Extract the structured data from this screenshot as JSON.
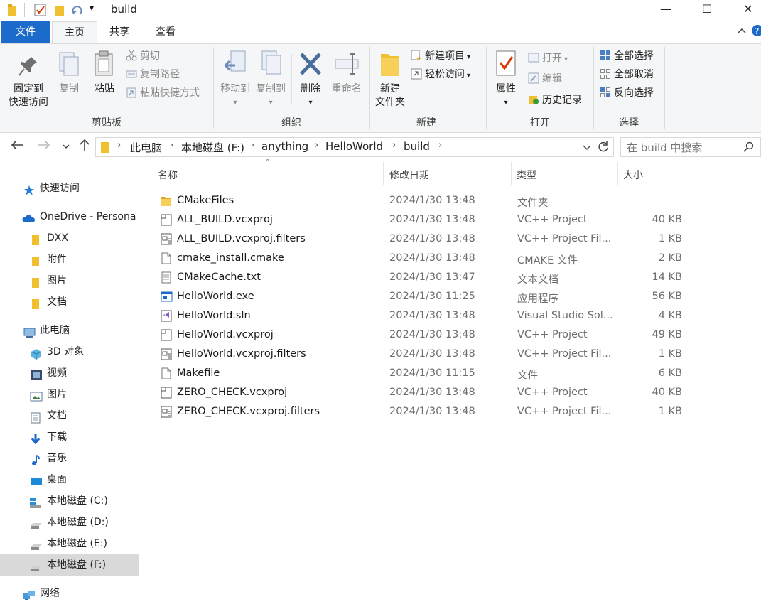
{
  "window": {
    "title": "build",
    "minimize": "—",
    "maximize": "☐",
    "close": "✕",
    "quick_access_arrow": "▾"
  },
  "ribbon_tabs": [
    "文件",
    "主页",
    "共享",
    "查看"
  ],
  "ribbon": {
    "clipboard": {
      "pin_line1": "固定到",
      "pin_line2": "快速访问",
      "copy": "复制",
      "paste": "粘贴",
      "cut": "剪切",
      "copy_path": "复制路径",
      "paste_shortcut": "粘贴快捷方式",
      "label": "剪贴板"
    },
    "organize": {
      "move_to": "移动到",
      "copy_to": "复制到",
      "delete": "删除",
      "rename": "重命名",
      "label": "组织"
    },
    "new": {
      "new_folder_line1": "新建",
      "new_folder_line2": "文件夹",
      "new_item": "新建项目",
      "easy_access": "轻松访问",
      "label": "新建"
    },
    "open": {
      "properties": "属性",
      "open": "打开",
      "edit": "编辑",
      "history": "历史记录",
      "label": "打开"
    },
    "select": {
      "select_all": "全部选择",
      "select_none": "全部取消",
      "invert": "反向选择",
      "label": "选择"
    }
  },
  "address": {
    "crumbs": [
      "此电脑",
      "本地磁盘 (F:)",
      "anything",
      "HelloWorld",
      "build"
    ],
    "search_placeholder": "在 build 中搜索"
  },
  "sidebar": [
    {
      "label": "快速访问",
      "icon": "star-icon"
    },
    {
      "label": "OneDrive - Persona",
      "icon": "cloud-icon"
    },
    {
      "label": "DXX",
      "icon": "folder-icon"
    },
    {
      "label": "附件",
      "icon": "folder-icon"
    },
    {
      "label": "图片",
      "icon": "folder-icon"
    },
    {
      "label": "文档",
      "icon": "folder-icon"
    },
    {
      "label": "此电脑",
      "icon": "computer-icon"
    },
    {
      "label": "3D 对象",
      "icon": "cube-icon"
    },
    {
      "label": "视频",
      "icon": "film-icon"
    },
    {
      "label": "图片",
      "icon": "picture-icon"
    },
    {
      "label": "文档",
      "icon": "document-icon"
    },
    {
      "label": "下载",
      "icon": "download-icon"
    },
    {
      "label": "音乐",
      "icon": "music-icon"
    },
    {
      "label": "桌面",
      "icon": "desktop-icon"
    },
    {
      "label": "本地磁盘 (C:)",
      "icon": "drive-icon"
    },
    {
      "label": "本地磁盘 (D:)",
      "icon": "drive-icon"
    },
    {
      "label": "本地磁盘 (E:)",
      "icon": "drive-icon"
    },
    {
      "label": "本地磁盘 (F:)",
      "icon": "drive-icon",
      "selected": true
    },
    {
      "label": "网络",
      "icon": "network-icon"
    }
  ],
  "columns": {
    "name": "名称",
    "date": "修改日期",
    "type": "类型",
    "size": "大小",
    "sort_indicator": "^"
  },
  "files": [
    {
      "name": "CMakeFiles",
      "date": "2024/1/30 13:48",
      "type": "文件夹",
      "size": "",
      "icon": "folder-icon"
    },
    {
      "name": "ALL_BUILD.vcxproj",
      "date": "2024/1/30 13:48",
      "type": "VC++ Project",
      "size": "40 KB",
      "icon": "vcxproj-icon"
    },
    {
      "name": "ALL_BUILD.vcxproj.filters",
      "date": "2024/1/30 13:48",
      "type": "VC++ Project Fil...",
      "size": "1 KB",
      "icon": "filters-icon"
    },
    {
      "name": "cmake_install.cmake",
      "date": "2024/1/30 13:48",
      "type": "CMAKE 文件",
      "size": "2 KB",
      "icon": "file-icon"
    },
    {
      "name": "CMakeCache.txt",
      "date": "2024/1/30 13:47",
      "type": "文本文档",
      "size": "14 KB",
      "icon": "text-file-icon"
    },
    {
      "name": "HelloWorld.exe",
      "date": "2024/1/30 11:25",
      "type": "应用程序",
      "size": "56 KB",
      "icon": "exe-icon"
    },
    {
      "name": "HelloWorld.sln",
      "date": "2024/1/30 13:48",
      "type": "Visual Studio Sol...",
      "size": "4 KB",
      "icon": "sln-icon"
    },
    {
      "name": "HelloWorld.vcxproj",
      "date": "2024/1/30 13:48",
      "type": "VC++ Project",
      "size": "49 KB",
      "icon": "vcxproj-icon"
    },
    {
      "name": "HelloWorld.vcxproj.filters",
      "date": "2024/1/30 13:48",
      "type": "VC++ Project Fil...",
      "size": "1 KB",
      "icon": "filters-icon"
    },
    {
      "name": "Makefile",
      "date": "2024/1/30 11:15",
      "type": "文件",
      "size": "6 KB",
      "icon": "file-icon"
    },
    {
      "name": "ZERO_CHECK.vcxproj",
      "date": "2024/1/30 13:48",
      "type": "VC++ Project",
      "size": "40 KB",
      "icon": "vcxproj-icon"
    },
    {
      "name": "ZERO_CHECK.vcxproj.filters",
      "date": "2024/1/30 13:48",
      "type": "VC++ Project Fil...",
      "size": "1 KB",
      "icon": "filters-icon"
    }
  ],
  "colors": {
    "accent": "#1c6ac9",
    "folder": "#f0c030",
    "selected": "#d9d9d9"
  }
}
